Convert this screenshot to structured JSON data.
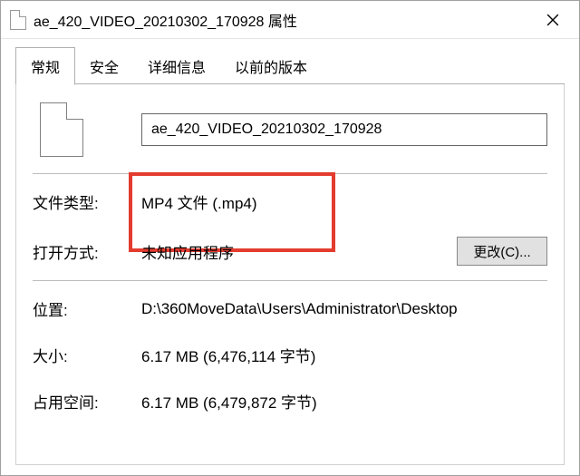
{
  "window": {
    "title": "ae_420_VIDEO_20210302_170928 属性"
  },
  "tabs": {
    "general": "常规",
    "security": "安全",
    "details": "详细信息",
    "previous": "以前的版本"
  },
  "filename": {
    "value": "ae_420_VIDEO_20210302_170928"
  },
  "labels": {
    "filetype": "文件类型:",
    "opens_with": "打开方式:",
    "location": "位置:",
    "size": "大小:",
    "size_on_disk": "占用空间:",
    "change": "更改(C)..."
  },
  "values": {
    "filetype": "MP4 文件 (.mp4)",
    "opens_with": "未知应用程序",
    "location": "D:\\360MoveData\\Users\\Administrator\\Desktop",
    "size": "6.17 MB (6,476,114 字节)",
    "size_on_disk": "6.17 MB (6,479,872 字节)"
  }
}
